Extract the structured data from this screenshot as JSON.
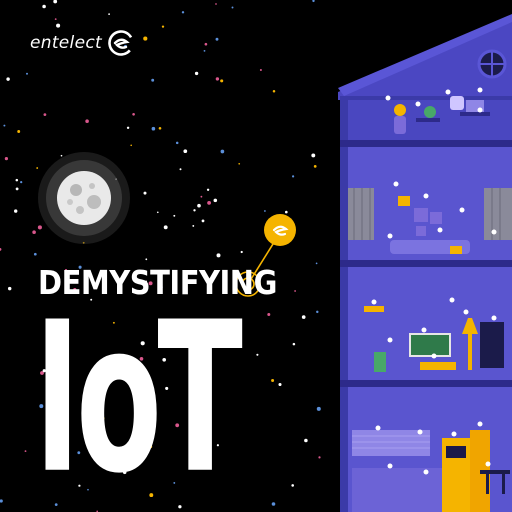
{
  "brand": {
    "name": "entelect",
    "logo_icon": "entelect-e-logo-icon"
  },
  "hero": {
    "subtitle": "DEMYSTIFYING",
    "headline": "IoT"
  },
  "colors": {
    "background": "#000000",
    "house_wall": "#3b3aa8",
    "house_floor": "#2d2a8a",
    "room_light": "#6c63d6",
    "accent_yellow": "#f5b400",
    "star_pink": "#d9578c",
    "star_blue": "#5b8fd9",
    "star_yellow": "#f5b400"
  },
  "icons": [
    "moon-icon",
    "entelect-pin-icon",
    "smart-home-building-icon"
  ]
}
